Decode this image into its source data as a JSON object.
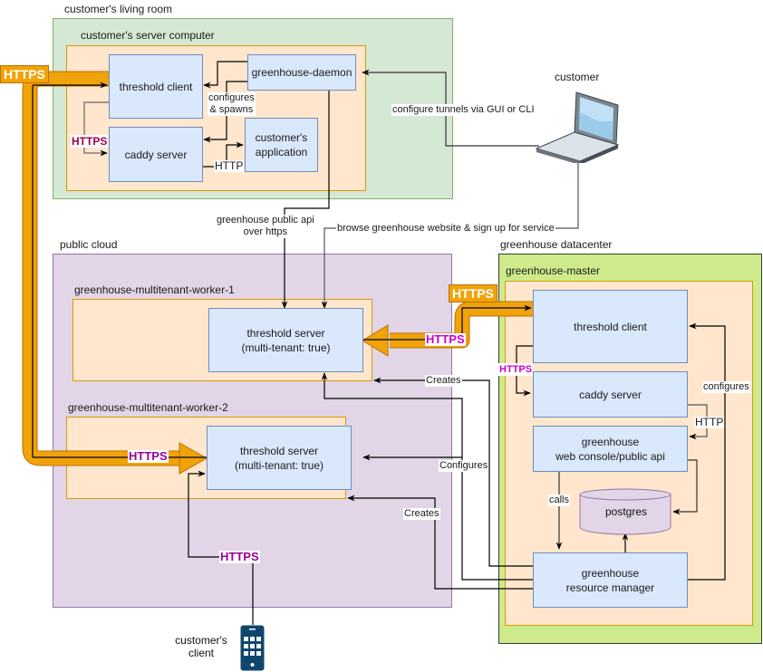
{
  "colors": {
    "living_room_fill": "#d5e8d4",
    "public_cloud_fill": "#e1d5e7",
    "datacenter_fill": "#cdeb8b",
    "machine_fill": "#ffe6cc",
    "node_fill": "#dae8fc",
    "https_pipe": "#f0a30a",
    "https_text_magenta": "#cc00cc",
    "https_text_purple": "#990099"
  },
  "groups": {
    "living_room": "customer's living room",
    "server_computer": "customer's server computer",
    "public_cloud": "public cloud",
    "worker1": "greenhouse-multitenant-worker-1",
    "worker2": "greenhouse-multitenant-worker-2",
    "datacenter": "greenhouse datacenter",
    "master": "greenhouse-master"
  },
  "nodes": {
    "customer_threshold_client": "threshold client",
    "greenhouse_daemon": "greenhouse-daemon",
    "customer_caddy": "caddy server",
    "customer_application": "customer's\napplication",
    "worker1_threshold_server": "threshold server\n(multi-tenant: true)",
    "worker2_threshold_server": "threshold server\n(multi-tenant: true)",
    "master_threshold_client": "threshold client",
    "master_caddy": "caddy server",
    "web_console": "greenhouse\nweb console/public api",
    "postgres": "postgres",
    "resource_manager": "greenhouse\nresource manager"
  },
  "actors": {
    "customer": "customer",
    "customers_client": "customer's\nclient"
  },
  "edge_labels": {
    "configures_spawns": "configures\n& spawns",
    "https_customer_local": "HTTPS",
    "http_customer_app": "HTTP",
    "configure_tunnels": "configure tunnels via GUI or CLI",
    "public_api": "greenhouse public api\nover https",
    "browse_website": "browse greenhouse website & sign up for service",
    "https_tag_left": "HTTPS",
    "https_tag_master": "HTTPS",
    "https_worker1_arrow": "HTTPS",
    "https_worker2_arrow": "HTTPS",
    "https_master_local": "HTTPS",
    "http_master": "HTTP",
    "configures_master": "configures",
    "calls": "calls",
    "creates_worker1": "Creates",
    "configures_workers": "Configures",
    "creates_worker2": "Creates",
    "https_client": "HTTPS"
  }
}
